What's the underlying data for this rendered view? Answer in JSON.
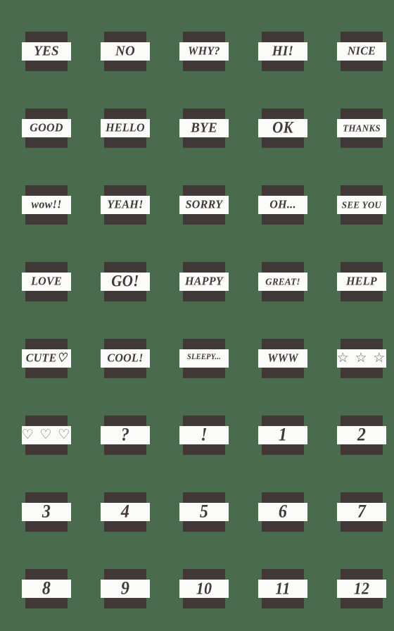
{
  "sheet": {
    "title": "Emoji sticker sheet",
    "background_color": "#4a6b4d",
    "tile_dark_color": "#413838",
    "tile_band_color": "#fbfbf9",
    "columns": 5,
    "rows": 8,
    "total_stickers": 40
  },
  "stickers": [
    {
      "text": "YES",
      "size": "s",
      "kind": "word"
    },
    {
      "text": "NO",
      "size": "s",
      "kind": "word"
    },
    {
      "text": "WHY?",
      "size": "m",
      "kind": "word"
    },
    {
      "text": "HI!",
      "size": "s",
      "kind": "word"
    },
    {
      "text": "NICE",
      "size": "m",
      "kind": "word"
    },
    {
      "text": "GOOD",
      "size": "m",
      "kind": "word"
    },
    {
      "text": "HELLO",
      "size": "m",
      "kind": "word"
    },
    {
      "text": "BYE",
      "size": "s",
      "kind": "word"
    },
    {
      "text": "OK",
      "size": "xs",
      "kind": "word"
    },
    {
      "text": "THANKS",
      "size": "l",
      "kind": "word"
    },
    {
      "text": "wow!!",
      "size": "m",
      "kind": "word"
    },
    {
      "text": "YEAH!",
      "size": "m",
      "kind": "word"
    },
    {
      "text": "SORRY",
      "size": "m",
      "kind": "word"
    },
    {
      "text": "OH...",
      "size": "m",
      "kind": "word"
    },
    {
      "text": "SEE YOU",
      "size": "l",
      "kind": "word"
    },
    {
      "text": "LOVE",
      "size": "m",
      "kind": "word"
    },
    {
      "text": "GO!",
      "size": "xs",
      "kind": "word"
    },
    {
      "text": "HAPPY",
      "size": "m",
      "kind": "word"
    },
    {
      "text": "GREAT!",
      "size": "l",
      "kind": "word"
    },
    {
      "text": "HELP",
      "size": "m",
      "kind": "word"
    },
    {
      "text": "CUTE♡",
      "size": "m",
      "kind": "word"
    },
    {
      "text": "COOL!",
      "size": "m",
      "kind": "word"
    },
    {
      "text": "SLEEPY...",
      "size": "xl",
      "kind": "word"
    },
    {
      "text": "WWW",
      "size": "m",
      "kind": "word"
    },
    {
      "text": "☆ ☆ ☆",
      "size": "m",
      "kind": "symbol"
    },
    {
      "text": "♡ ♡ ♡",
      "size": "m",
      "kind": "symbol"
    },
    {
      "text": "?",
      "size": "num",
      "kind": "mark"
    },
    {
      "text": "!",
      "size": "num",
      "kind": "mark"
    },
    {
      "text": "1",
      "size": "num",
      "kind": "number"
    },
    {
      "text": "2",
      "size": "num",
      "kind": "number"
    },
    {
      "text": "3",
      "size": "num",
      "kind": "number"
    },
    {
      "text": "4",
      "size": "num",
      "kind": "number"
    },
    {
      "text": "5",
      "size": "num",
      "kind": "number"
    },
    {
      "text": "6",
      "size": "num",
      "kind": "number"
    },
    {
      "text": "7",
      "size": "num",
      "kind": "number"
    },
    {
      "text": "8",
      "size": "num",
      "kind": "number"
    },
    {
      "text": "9",
      "size": "num",
      "kind": "number"
    },
    {
      "text": "10",
      "size": "num2",
      "kind": "number"
    },
    {
      "text": "11",
      "size": "num2",
      "kind": "number"
    },
    {
      "text": "12",
      "size": "num2",
      "kind": "number"
    }
  ]
}
